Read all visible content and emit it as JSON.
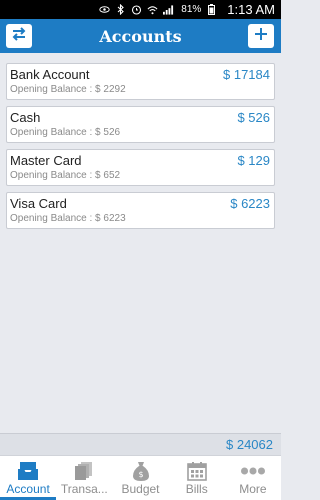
{
  "status_bar": {
    "battery": "81%",
    "time": "1:13 AM"
  },
  "app_bar": {
    "title": "Accounts",
    "left_icon": "swap-arrows-icon",
    "right_icon": "plus-icon"
  },
  "accounts": [
    {
      "name": "Bank Account",
      "amount": "$ 17184",
      "opening": "Opening Balance : $ 2292"
    },
    {
      "name": "Cash",
      "amount": "$ 526",
      "opening": "Opening Balance : $ 526"
    },
    {
      "name": "Master Card",
      "amount": "$ 129",
      "opening": "Opening Balance : $ 652"
    },
    {
      "name": "Visa Card",
      "amount": "$ 6223",
      "opening": "Opening Balance : $ 6223"
    }
  ],
  "total": "$ 24062",
  "tabs": [
    {
      "label": "Account",
      "icon": "inbox-tray-icon",
      "active": true
    },
    {
      "label": "Transa...",
      "icon": "documents-icon",
      "active": false
    },
    {
      "label": "Budget",
      "icon": "money-bag-icon",
      "active": false
    },
    {
      "label": "Bills",
      "icon": "calendar-icon",
      "active": false
    },
    {
      "label": "More",
      "icon": "more-dots-icon",
      "active": false
    }
  ],
  "colors": {
    "primary": "#1e7cc4",
    "amount": "#2a87c6",
    "background": "#e8eaef"
  }
}
